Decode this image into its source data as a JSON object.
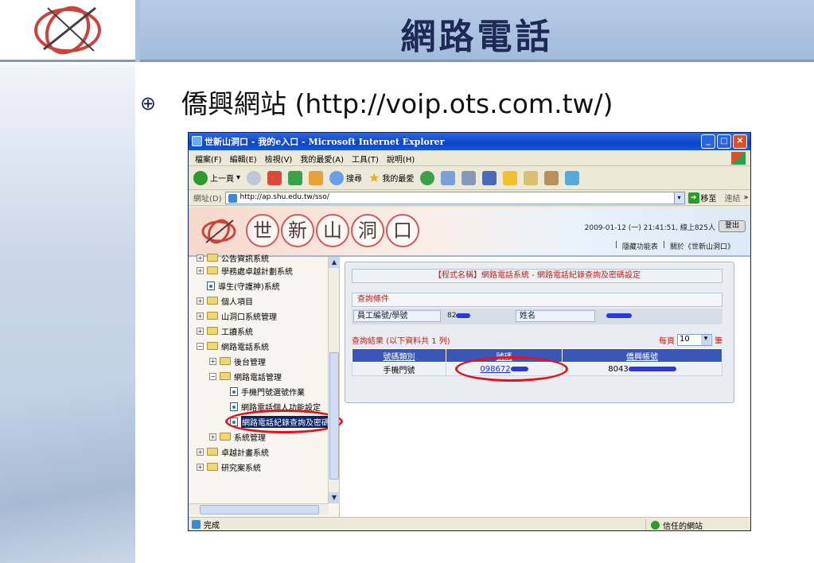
{
  "slide": {
    "title": "網路電話",
    "bullet_text": "僑興網站 (http://voip.ots.com.tw/)"
  },
  "window": {
    "title": "世新山洞口 - 我的e入口 - Microsoft Internet Explorer",
    "menus": [
      "檔案(F)",
      "編輯(E)",
      "檢視(V)",
      "我的最愛(A)",
      "工具(T)",
      "說明(H)"
    ],
    "toolbar": {
      "back_label": "上一頁",
      "search_label": "搜尋",
      "favorites_label": "我的最愛"
    },
    "address": {
      "label": "網址(D)",
      "url": "http://ap.shu.edu.tw/sso/",
      "go_label": "移至",
      "links_label": "連結"
    },
    "status": {
      "text": "完成",
      "zone": "信任的網站"
    }
  },
  "site": {
    "name_chars": [
      "世",
      "新",
      "山",
      "洞",
      "口"
    ],
    "datetime": "2009-01-12 (一) 21:41:51, 線上825人",
    "logout_label": "登出",
    "hide_menu_label": "隱藏功能表",
    "about_label": "關於《世新山洞口》"
  },
  "tree": {
    "items": [
      {
        "label": "公告資訊系統",
        "type": "folder",
        "expander": "+"
      },
      {
        "label": "學務處卓越計劃系統",
        "type": "folder",
        "expander": "+"
      },
      {
        "label": "導生(守護神)系統",
        "type": "page",
        "expander": ""
      },
      {
        "label": "個人項目",
        "type": "folder",
        "expander": "+"
      },
      {
        "label": "山洞口系統管理",
        "type": "folder",
        "expander": "+"
      },
      {
        "label": "工讀系統",
        "type": "folder",
        "expander": "+"
      },
      {
        "label": "網路電話系統",
        "type": "folder",
        "expander": "−"
      },
      {
        "label": "後台管理",
        "type": "folder",
        "expander": "+"
      },
      {
        "label": "網路電話管理",
        "type": "folder",
        "expander": "−"
      },
      {
        "label": "手機門號選號作業",
        "type": "page",
        "expander": ""
      },
      {
        "label": "網路電話個人功能設定",
        "type": "page",
        "expander": ""
      },
      {
        "label": "網路電話紀錄查詢及密碼",
        "type": "page",
        "expander": ""
      },
      {
        "label": "系統管理",
        "type": "folder",
        "expander": "+"
      },
      {
        "label": "卓越計畫系統",
        "type": "folder",
        "expander": "+"
      },
      {
        "label": "研究案系統",
        "type": "folder",
        "expander": "+"
      }
    ]
  },
  "main": {
    "program_title": "【程式名稱】網路電話系統 - 網路電話紀錄查詢及密碼設定",
    "conditions_label": "查詢條件",
    "emp_field_label": "員工編號/學號",
    "emp_value": "82",
    "name_field_label": "姓名",
    "results_label": "查詢結果 (以下資料共 1 列)",
    "per_page_label": "每頁",
    "per_page_value": "10",
    "per_page_suffix": "筆",
    "table": {
      "headers": [
        "號碼類別",
        "號碼",
        "僑興帳號"
      ],
      "rows": [
        [
          "手機門號",
          "098672",
          "8043"
        ]
      ]
    }
  },
  "colors": {
    "title_text": "#1c2a55",
    "titlebar_blue": "#0c44c8",
    "accent_red": "#c0201a",
    "highlight_oval": "#e0141e",
    "table_header": "#3a56b8"
  }
}
